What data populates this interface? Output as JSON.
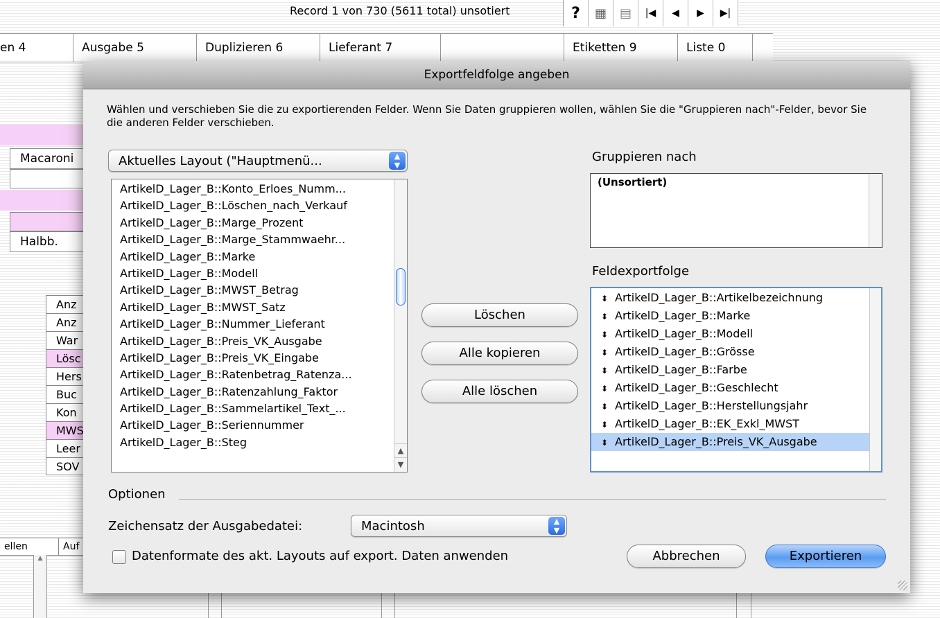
{
  "record_status": "Record 1 von 730 (5611 total) unsotiert",
  "nav_buttons": [
    "?",
    "▦",
    "▤",
    "|◀",
    "◀",
    "▶",
    "▶|"
  ],
  "menu": [
    "en  4",
    "Ausgabe  5",
    "Duplizieren  6",
    "Lieferant     7",
    "",
    "Etiketten 9",
    "Liste  0"
  ],
  "bg_fields": {
    "macaroni": "Macaroni",
    "halbb": "Halbb.",
    "col_items": [
      "Anz",
      "Anz",
      "War",
      "Lösc",
      "Hers",
      "Buc",
      "Kon",
      "MWS",
      "Leer",
      "SOV"
    ],
    "bottom_headers": [
      "ellen",
      "Auf"
    ]
  },
  "dialog": {
    "title": "Exportfeldfolge angeben",
    "instructions": "Wählen und verschieben Sie die zu exportierenden Felder.  Wenn Sie Daten gruppieren wollen, wählen Sie die \"Gruppieren nach\"-Felder, bevor Sie die anderen Felder verschieben.",
    "source_popup": "Aktuelles Layout (\"Hauptmenü...",
    "source_fields": [
      "ArtikelD_Lager_B::Konto_Erloes_Numm...",
      "ArtikelD_Lager_B::Löschen_nach_Verkauf",
      "ArtikelD_Lager_B::Marge_Prozent",
      "ArtikelD_Lager_B::Marge_Stammwaehr...",
      "ArtikelD_Lager_B::Marke",
      "ArtikelD_Lager_B::Modell",
      "ArtikelD_Lager_B::MWST_Betrag",
      "ArtikelD_Lager_B::MWST_Satz",
      "ArtikelD_Lager_B::Nummer_Lieferant",
      "ArtikelD_Lager_B::Preis_VK_Ausgabe",
      "ArtikelD_Lager_B::Preis_VK_Eingabe",
      "ArtikelD_Lager_B::Ratenbetrag_Ratenza...",
      "ArtikelD_Lager_B::Ratenzahlung_Faktor",
      "ArtikelD_Lager_B::Sammelartikel_Text_...",
      "ArtikelD_Lager_B::Seriennummer",
      "ArtikelD_Lager_B::Steg"
    ],
    "buttons": {
      "delete": "Löschen",
      "copy_all": "Alle kopieren",
      "delete_all": "Alle löschen",
      "cancel": "Abbrechen",
      "export": "Exportieren"
    },
    "group_label": "Gruppieren nach",
    "group_items": [
      "(Unsortiert)"
    ],
    "export_order_label": "Feldexportfolge",
    "export_fields": [
      "ArtikelD_Lager_B::Artikelbezeichnung",
      "ArtikelD_Lager_B::Marke",
      "ArtikelD_Lager_B::Modell",
      "ArtikelD_Lager_B::Grösse",
      "ArtikelD_Lager_B::Farbe",
      "ArtikelD_Lager_B::Geschlecht",
      "ArtikelD_Lager_B::Herstellungsjahr",
      "ArtikelD_Lager_B::EK_Exkl_MWST",
      "ArtikelD_Lager_B::Preis_VK_Ausgabe"
    ],
    "selected_export_field": "ArtikelD_Lager_B::Preis_VK_Ausgabe",
    "options_label": "Optionen",
    "charset_label": "Zeichensatz der Ausgabedatei:",
    "charset_value": "Macintosh",
    "apply_formats_label": "Datenformate des akt. Layouts auf export. Daten anwenden",
    "apply_formats_checked": false
  },
  "colors": {
    "pink_field": "#f6d0f6",
    "selection": "#b7d4f8",
    "default_button": "#5a9cf2"
  }
}
